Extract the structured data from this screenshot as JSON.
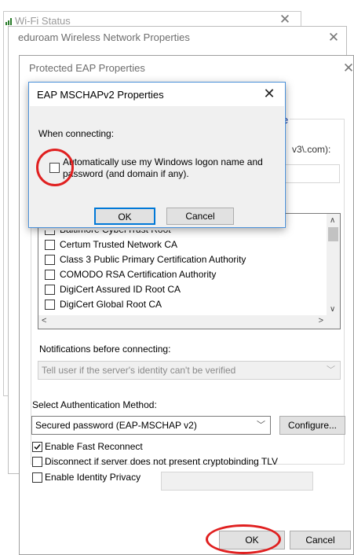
{
  "wifi_status": {
    "title": "Wi-Fi Status"
  },
  "eduroam": {
    "title": "eduroam Wireless Network Properties"
  },
  "peap": {
    "title": "Protected EAP Properties",
    "partial_heading": "e",
    "partial_text": "v3\\.com):",
    "cert_list": [
      "Baltimore CyberTrust Root",
      "Certum Trusted Network CA",
      "Class 3 Public Primary Certification Authority",
      "COMODO RSA Certification Authority",
      "DigiCert Assured ID Root CA",
      "DigiCert Global Root CA"
    ],
    "notifications_label": "Notifications before connecting:",
    "notifications_value": "Tell user if the server's identity can't be verified",
    "auth_method_label": "Select Authentication Method:",
    "auth_method_value": "Secured password (EAP-MSCHAP v2)",
    "configure_label": "Configure...",
    "fast_reconnect_label": "Enable Fast Reconnect",
    "fast_reconnect_checked": true,
    "disconnect_label": "Disconnect if server does not present cryptobinding TLV",
    "disconnect_checked": false,
    "identity_privacy_label": "Enable Identity Privacy",
    "identity_privacy_checked": false,
    "ok_label": "OK",
    "cancel_label": "Cancel"
  },
  "mschap": {
    "title": "EAP MSCHAPv2 Properties",
    "when_connecting": "When connecting:",
    "auto_logon_line1": "Automatically use my Windows logon name and",
    "auto_logon_line2": "password (and domain if any).",
    "auto_logon_checked": false,
    "ok_label": "OK",
    "cancel_label": "Cancel"
  },
  "colors": {
    "annotation": "#e02020",
    "focus_blue": "#0078d7"
  },
  "icons": {
    "close": "close-icon",
    "dropdown": "chevron-down-icon",
    "scroll_up": "chevron-up-icon",
    "scroll_down": "chevron-down-icon",
    "scroll_left": "chevron-left-icon",
    "scroll_right": "chevron-right-icon",
    "wifi": "wifi-icon"
  }
}
